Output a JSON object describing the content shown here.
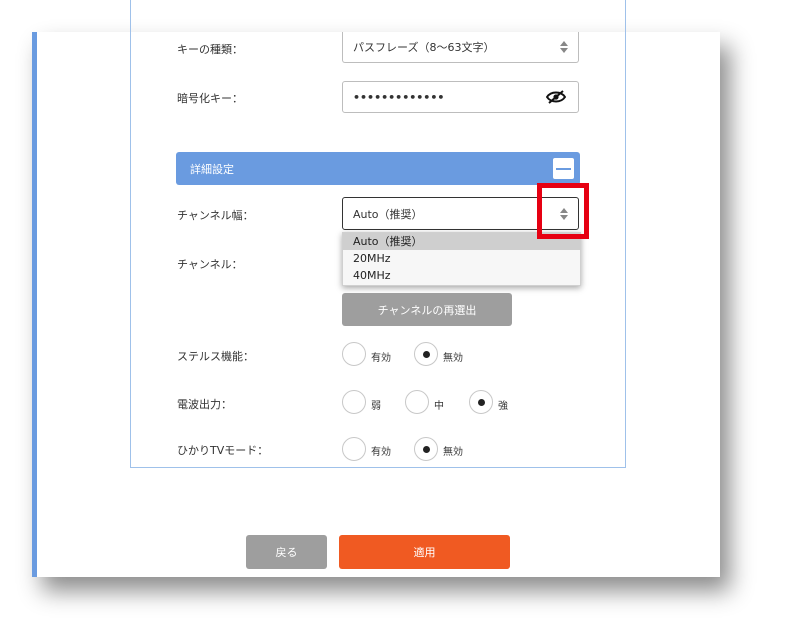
{
  "form": {
    "key_type_label": "キーの種類：",
    "key_type_value": "パスフレーズ（8〜63文字）",
    "enc_key_label": "暗号化キー：",
    "enc_key_value": "•••••••••••••",
    "section_title": "詳細設定",
    "channel_width_label": "チャンネル幅：",
    "channel_width_value": "Auto（推奨）",
    "channel_width_options": [
      "Auto（推奨）",
      "20MHz",
      "40MHz"
    ],
    "channel_label": "チャンネル：",
    "rescan_button": "チャンネルの再選出",
    "stealth_label": "ステルス機能：",
    "stealth_options": [
      "有効",
      "無効"
    ],
    "stealth_selected": "無効",
    "power_label": "電波出力：",
    "power_options": [
      "弱",
      "中",
      "強"
    ],
    "power_selected": "強",
    "hikari_label": "ひかりTVモード：",
    "hikari_options": [
      "有効",
      "無効"
    ],
    "hikari_selected": "無効"
  },
  "footer": {
    "back_button": "戻る",
    "apply_button": "適用"
  },
  "colors": {
    "accent_blue": "#6a9be0",
    "apply_orange": "#f05a22",
    "back_gray": "#9e9e9e",
    "highlight_red": "#e60012"
  },
  "icons": {
    "password_toggle": "eye-slash-icon",
    "select_arrows": "updown-arrows-icon",
    "collapse": "minus-icon"
  }
}
